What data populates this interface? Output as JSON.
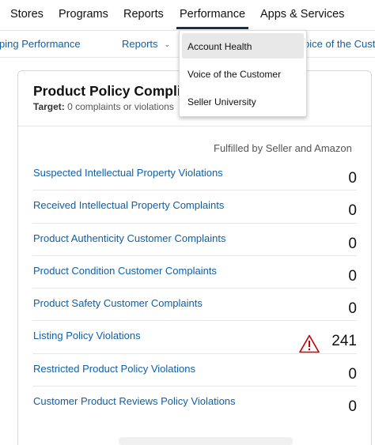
{
  "topnav": {
    "items": [
      "Stores",
      "Programs",
      "Reports",
      "Performance",
      "Apps & Services"
    ]
  },
  "subnav": {
    "items": [
      "ping Performance",
      "Reports",
      "oice of the Cust"
    ]
  },
  "dropdown": {
    "items": [
      "Account Health",
      "Voice of the Customer",
      "Seller University"
    ]
  },
  "card": {
    "title": "Product Policy Complia",
    "target_label": "Target:",
    "target_value": " 0 complaints or violations",
    "column_header": "Fulfilled by Seller and Amazon",
    "rows": [
      {
        "label": "Suspected Intellectual Property Violations",
        "value": "0"
      },
      {
        "label": "Received Intellectual Property Complaints",
        "value": "0"
      },
      {
        "label": "Product Authenticity Customer Complaints",
        "value": "0"
      },
      {
        "label": "Product Condition Customer Complaints",
        "value": "0"
      },
      {
        "label": "Product Safety Customer Complaints",
        "value": "0"
      },
      {
        "label": "Listing Policy Violations",
        "value": "241",
        "warning": true
      },
      {
        "label": "Restricted Product Policy Violations",
        "value": "0"
      },
      {
        "label": "Customer Product Reviews Policy Violations",
        "value": "0"
      }
    ]
  },
  "icons": {
    "warning": "warning-triangle-icon",
    "caret": "chevron-down-icon"
  },
  "colors": {
    "link": "#0f5fa7",
    "warning": "#c40000",
    "active_underline": "#232f3e"
  }
}
